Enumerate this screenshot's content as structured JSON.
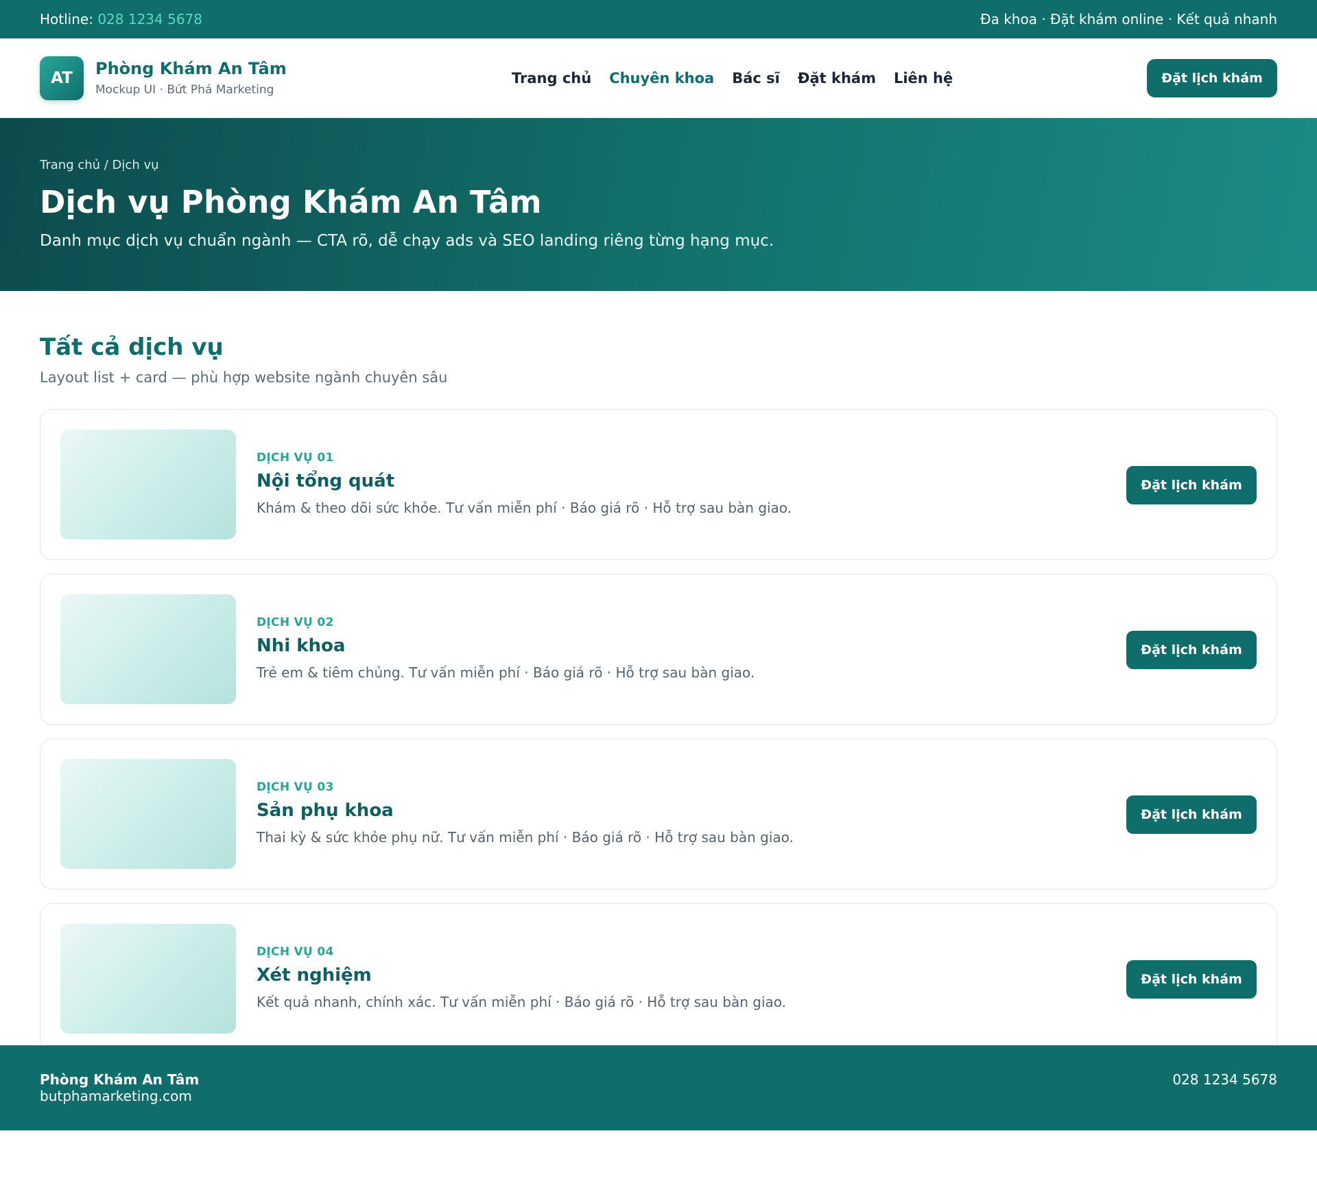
{
  "topbar": {
    "hotline_label": "Hotline:",
    "hotline_value": "028 1234 5678",
    "tagline": "Đa khoa · Đặt khám online · Kết quả nhanh"
  },
  "header": {
    "logo_initials": "AT",
    "brand_name": "Phòng Khám An Tâm",
    "brand_sub": "Mockup UI · Bứt Phá Marketing",
    "nav": [
      {
        "label": "Trang chủ",
        "active": false
      },
      {
        "label": "Chuyên khoa",
        "active": true
      },
      {
        "label": "Bác sĩ",
        "active": false
      },
      {
        "label": "Đặt khám",
        "active": false
      },
      {
        "label": "Liên hệ",
        "active": false
      }
    ],
    "cta_label": "Đặt lịch khám"
  },
  "hero": {
    "breadcrumb": "Trang chủ / Dịch vụ",
    "title": "Dịch vụ Phòng Khám An Tâm",
    "description": "Danh mục dịch vụ chuẩn ngành — CTA rõ, dễ chạy ads và SEO landing riêng từng hạng mục."
  },
  "services_section": {
    "title": "Tất cả dịch vụ",
    "subtitle": "Layout list + card — phù hợp website ngành chuyên sâu",
    "items": [
      {
        "tag": "DỊCH VỤ 01",
        "title": "Nội tổng quát",
        "description": "Khám & theo dõi sức khỏe. Tư vấn miễn phí · Báo giá rõ · Hỗ trợ sau bàn giao.",
        "cta_label": "Đặt lịch khám"
      },
      {
        "tag": "DỊCH VỤ 02",
        "title": "Nhi khoa",
        "description": "Trẻ em & tiêm chủng. Tư vấn miễn phí · Báo giá rõ · Hỗ trợ sau bàn giao.",
        "cta_label": "Đặt lịch khám"
      },
      {
        "tag": "DỊCH VỤ 03",
        "title": "Sản phụ khoa",
        "description": "Thai kỳ & sức khỏe phụ nữ. Tư vấn miễn phí · Báo giá rõ · Hỗ trợ sau bàn giao.",
        "cta_label": "Đặt lịch khám"
      },
      {
        "tag": "DỊCH VỤ 04",
        "title": "Xét nghiệm",
        "description": "Kết quả nhanh, chính xác. Tư vấn miễn phí · Báo giá rõ · Hỗ trợ sau bàn giao.",
        "cta_label": "Đặt lịch khám"
      }
    ]
  },
  "footer": {
    "brand_name": "Phòng Khám An Tâm",
    "website": "butphamarketing.com",
    "phone": "028 1234 5678"
  },
  "colors": {
    "primary": "#0f6e6c",
    "accent": "#2aa596",
    "hotline": "#5fd6c3"
  }
}
